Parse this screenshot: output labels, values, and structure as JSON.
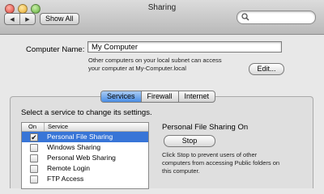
{
  "window": {
    "title": "Sharing"
  },
  "toolbar": {
    "back_glyph": "◀",
    "forward_glyph": "▶",
    "show_all_label": "Show All",
    "search_placeholder": ""
  },
  "computer": {
    "label": "Computer Name:",
    "value": "My Computer",
    "note_line1": "Other computers on your local subnet can access",
    "note_line2": "your computer at My-Computer.local",
    "edit_label": "Edit..."
  },
  "tabs": [
    {
      "label": "Services",
      "active": true
    },
    {
      "label": "Firewall",
      "active": false
    },
    {
      "label": "Internet",
      "active": false
    }
  ],
  "services": {
    "caption": "Select a service to change its settings.",
    "col_on": "On",
    "col_service": "Service",
    "rows": [
      {
        "on": true,
        "name": "Personal File Sharing",
        "selected": true
      },
      {
        "on": false,
        "name": "Windows Sharing",
        "selected": false
      },
      {
        "on": false,
        "name": "Personal Web Sharing",
        "selected": false
      },
      {
        "on": false,
        "name": "Remote Login",
        "selected": false
      },
      {
        "on": false,
        "name": "FTP Access",
        "selected": false
      }
    ],
    "check_glyph": "✔"
  },
  "detail": {
    "status": "Personal File Sharing On",
    "stop_label": "Stop",
    "help_line1": "Click Stop to prevent users of other",
    "help_line2": "computers from accessing Public folders on",
    "help_line3": "this computer."
  },
  "colors": {
    "selection": "#3875d7",
    "active_tab": "#4a8ee6"
  }
}
